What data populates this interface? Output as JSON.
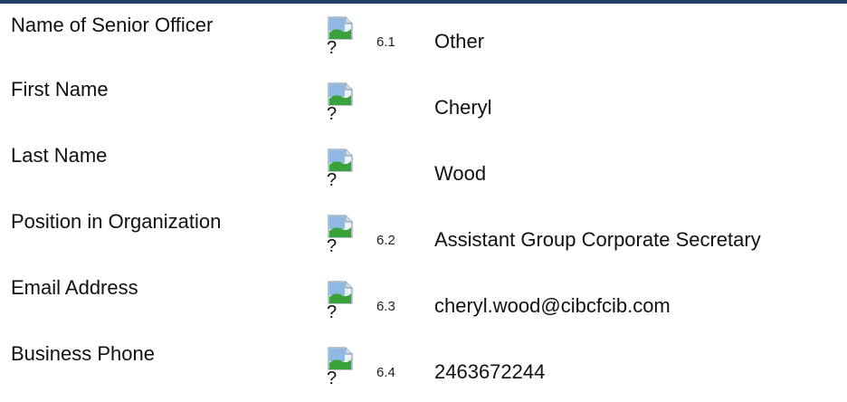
{
  "form": {
    "rows": [
      {
        "label": "Name of Senior Officer",
        "help": "?",
        "number": "6.1",
        "value": "Other"
      },
      {
        "label": "First Name",
        "help": "?",
        "number": "",
        "value": "Cheryl"
      },
      {
        "label": "Last Name",
        "help": "?",
        "number": "",
        "value": "Wood"
      },
      {
        "label": "Position in Organization",
        "help": "?",
        "number": "6.2",
        "value": "Assistant Group Corporate Secretary"
      },
      {
        "label": "Email Address",
        "help": "?",
        "number": "6.3",
        "value": "cheryl.wood@cibcfcib.com"
      },
      {
        "label": "Business Phone",
        "help": "?",
        "number": "6.4",
        "value": "2463672244"
      }
    ]
  },
  "colors": {
    "top_rule": "#1f3f66",
    "icon_frame": "#7a8ea3",
    "icon_sky": "#8fb8e3",
    "icon_grass": "#3aa23a"
  },
  "icons": {
    "help": "broken-image-icon"
  }
}
